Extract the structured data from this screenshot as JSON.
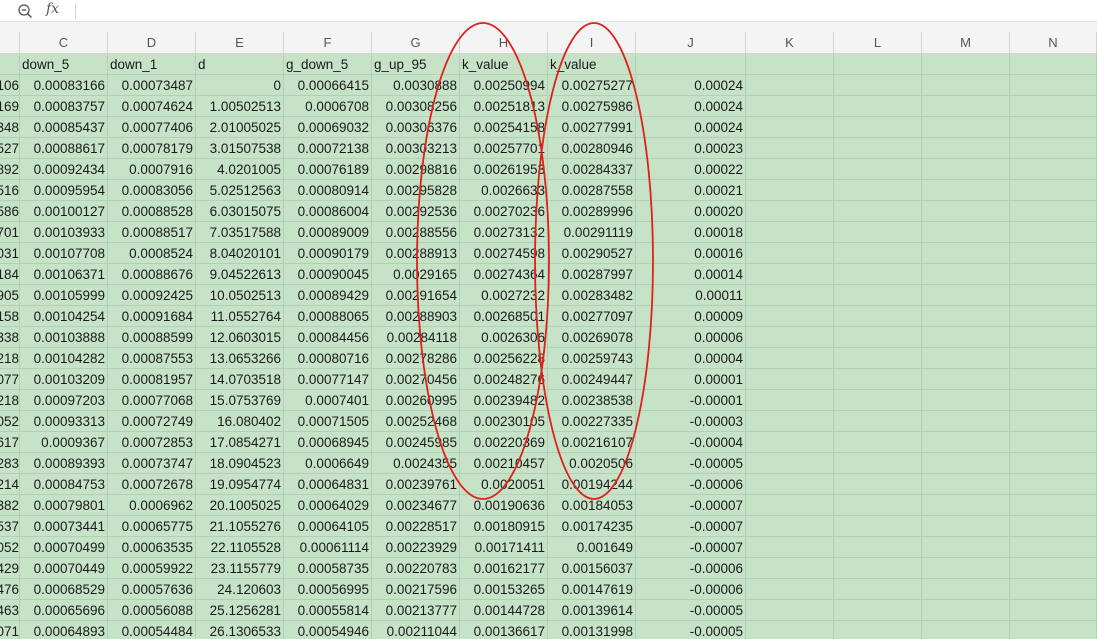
{
  "formula_bar": {
    "zoom_icon": "zoom-magnifier-icon",
    "fx_label": "fx",
    "formula_value": ""
  },
  "columns": [
    "C",
    "D",
    "E",
    "F",
    "G",
    "H",
    "I",
    "J",
    "K",
    "L",
    "M",
    "N"
  ],
  "header_row": [
    "down_5",
    "down_1",
    "d",
    "g_down_5",
    "g_up_95",
    "k_value",
    "k_value",
    "",
    "",
    "",
    "",
    ""
  ],
  "rows": [
    {
      "a": "106",
      "c": "0.00083166",
      "d": "0.00073487",
      "e": "0",
      "f": "0.00066415",
      "g": "0.0030888",
      "h": "0.00250994",
      "i": "0.00275277",
      "j": "0.00024"
    },
    {
      "a": "169",
      "c": "0.00083757",
      "d": "0.00074624",
      "e": "1.00502513",
      "f": "0.0006708",
      "g": "0.00308256",
      "h": "0.00251813",
      "i": "0.00275986",
      "j": "0.00024"
    },
    {
      "a": "348",
      "c": "0.00085437",
      "d": "0.00077406",
      "e": "2.01005025",
      "f": "0.00069032",
      "g": "0.00306376",
      "h": "0.00254158",
      "i": "0.00277991",
      "j": "0.00024"
    },
    {
      "a": "527",
      "c": "0.00088617",
      "d": "0.00078179",
      "e": "3.01507538",
      "f": "0.00072138",
      "g": "0.00303213",
      "h": "0.00257701",
      "i": "0.00280946",
      "j": "0.00023"
    },
    {
      "a": "892",
      "c": "0.00092434",
      "d": "0.0007916",
      "e": "4.0201005",
      "f": "0.00076189",
      "g": "0.00298816",
      "h": "0.00261953",
      "i": "0.00284337",
      "j": "0.00022"
    },
    {
      "a": "516",
      "c": "0.00095954",
      "d": "0.00083056",
      "e": "5.02512563",
      "f": "0.00080914",
      "g": "0.00295828",
      "h": "0.0026633",
      "i": "0.00287558",
      "j": "0.00021"
    },
    {
      "a": "586",
      "c": "0.00100127",
      "d": "0.00088528",
      "e": "6.03015075",
      "f": "0.00086004",
      "g": "0.00292536",
      "h": "0.00270236",
      "i": "0.00289996",
      "j": "0.00020"
    },
    {
      "a": "701",
      "c": "0.00103933",
      "d": "0.00088517",
      "e": "7.03517588",
      "f": "0.00089009",
      "g": "0.00288556",
      "h": "0.00273132",
      "i": "0.00291119",
      "j": "0.00018"
    },
    {
      "a": "031",
      "c": "0.00107708",
      "d": "0.0008524",
      "e": "8.04020101",
      "f": "0.00090179",
      "g": "0.00288913",
      "h": "0.00274598",
      "i": "0.00290527",
      "j": "0.00016"
    },
    {
      "a": "184",
      "c": "0.00106371",
      "d": "0.00088676",
      "e": "9.04522613",
      "f": "0.00090045",
      "g": "0.0029165",
      "h": "0.00274364",
      "i": "0.00287997",
      "j": "0.00014"
    },
    {
      "a": "905",
      "c": "0.00105999",
      "d": "0.00092425",
      "e": "10.0502513",
      "f": "0.00089429",
      "g": "0.00291654",
      "h": "0.0027232",
      "i": "0.00283482",
      "j": "0.00011"
    },
    {
      "a": "158",
      "c": "0.00104254",
      "d": "0.00091684",
      "e": "11.0552764",
      "f": "0.00088065",
      "g": "0.00288903",
      "h": "0.00268501",
      "i": "0.00277097",
      "j": "0.00009"
    },
    {
      "a": "338",
      "c": "0.00103888",
      "d": "0.00088599",
      "e": "12.0603015",
      "f": "0.00084456",
      "g": "0.00284118",
      "h": "0.0026306",
      "i": "0.00269078",
      "j": "0.00006"
    },
    {
      "a": "218",
      "c": "0.00104282",
      "d": "0.00087553",
      "e": "13.0653266",
      "f": "0.00080716",
      "g": "0.00278286",
      "h": "0.00256228",
      "i": "0.00259743",
      "j": "0.00004"
    },
    {
      "a": "077",
      "c": "0.00103209",
      "d": "0.00081957",
      "e": "14.0703518",
      "f": "0.00077147",
      "g": "0.00270456",
      "h": "0.00248276",
      "i": "0.00249447",
      "j": "0.00001"
    },
    {
      "a": "218",
      "c": "0.00097203",
      "d": "0.00077068",
      "e": "15.0753769",
      "f": "0.0007401",
      "g": "0.00260995",
      "h": "0.00239482",
      "i": "0.00238538",
      "j": "-0.00001"
    },
    {
      "a": "052",
      "c": "0.00093313",
      "d": "0.00072749",
      "e": "16.080402",
      "f": "0.00071505",
      "g": "0.00252468",
      "h": "0.00230105",
      "i": "0.00227335",
      "j": "-0.00003"
    },
    {
      "a": "617",
      "c": "0.0009367",
      "d": "0.00072853",
      "e": "17.0854271",
      "f": "0.00068945",
      "g": "0.00245985",
      "h": "0.00220369",
      "i": "0.00216107",
      "j": "-0.00004"
    },
    {
      "a": "283",
      "c": "0.00089393",
      "d": "0.00073747",
      "e": "18.0904523",
      "f": "0.0006649",
      "g": "0.0024355",
      "h": "0.00210457",
      "i": "0.0020506",
      "j": "-0.00005"
    },
    {
      "a": "214",
      "c": "0.00084753",
      "d": "0.00072678",
      "e": "19.0954774",
      "f": "0.00064831",
      "g": "0.00239761",
      "h": "0.0020051",
      "i": "0.00194244",
      "j": "-0.00006"
    },
    {
      "a": "382",
      "c": "0.00079801",
      "d": "0.0006962",
      "e": "20.1005025",
      "f": "0.00064029",
      "g": "0.00234677",
      "h": "0.00190636",
      "i": "0.00184053",
      "j": "-0.00007"
    },
    {
      "a": "537",
      "c": "0.00073441",
      "d": "0.00065775",
      "e": "21.1055276",
      "f": "0.00064105",
      "g": "0.00228517",
      "h": "0.00180915",
      "i": "0.00174235",
      "j": "-0.00007"
    },
    {
      "a": "052",
      "c": "0.00070499",
      "d": "0.00063535",
      "e": "22.1105528",
      "f": "0.00061114",
      "g": "0.00223929",
      "h": "0.00171411",
      "i": "0.001649",
      "j": "-0.00007"
    },
    {
      "a": "429",
      "c": "0.00070449",
      "d": "0.00059922",
      "e": "23.1155779",
      "f": "0.00058735",
      "g": "0.00220783",
      "h": "0.00162177",
      "i": "0.00156037",
      "j": "-0.00006"
    },
    {
      "a": "476",
      "c": "0.00068529",
      "d": "0.00057636",
      "e": "24.120603",
      "f": "0.00056995",
      "g": "0.00217596",
      "h": "0.00153265",
      "i": "0.00147619",
      "j": "-0.00006"
    },
    {
      "a": "463",
      "c": "0.00065696",
      "d": "0.00056088",
      "e": "25.1256281",
      "f": "0.00055814",
      "g": "0.00213777",
      "h": "0.00144728",
      "i": "0.00139614",
      "j": "-0.00005"
    },
    {
      "a": "071",
      "c": "0.00064893",
      "d": "0.00054484",
      "e": "26.1306533",
      "f": "0.00054946",
      "g": "0.00211044",
      "h": "0.00136617",
      "i": "0.00131998",
      "j": "-0.00005"
    }
  ],
  "colors": {
    "grid_fill": "#c6e3c8",
    "annotation": "#e0201a"
  }
}
